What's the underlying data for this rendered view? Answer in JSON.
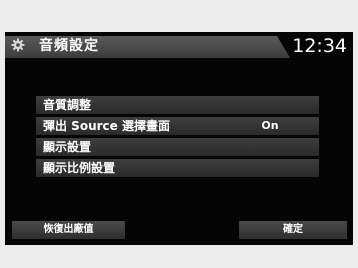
{
  "header": {
    "icon": "gear-icon",
    "title": "音頻設定",
    "clock": "12:34"
  },
  "menu": {
    "items": [
      {
        "label": "音質調整"
      },
      {
        "label": "彈出 Source 選擇畫面",
        "value": "On"
      },
      {
        "label": "顯示設置"
      },
      {
        "label": "顯示比例設置"
      }
    ]
  },
  "footer": {
    "reset_label": "恢復出廠值",
    "ok_label": "確定"
  }
}
